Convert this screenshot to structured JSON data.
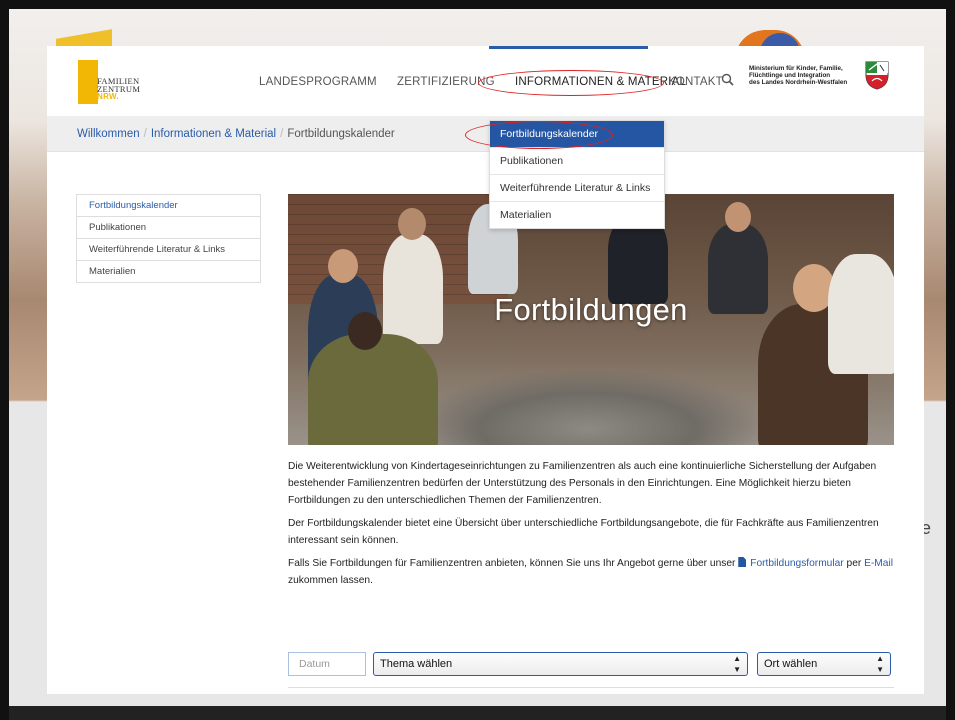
{
  "backdrop": {
    "side_text": "e"
  },
  "logo": {
    "line1": "FAMILIEN",
    "line2": "ZENTRUM",
    "line3": "NRW."
  },
  "nav": {
    "items": [
      "LANDESPROGRAMM",
      "ZERTIFIZIERUNG",
      "INFORMATIONEN & MATERIAL",
      "KONTAKT"
    ],
    "active": "INFORMATIONEN & MATERIAL"
  },
  "ministry": {
    "line1": "Ministerium für Kinder, Familie,",
    "line2": "Flüchtlinge und Integration",
    "line3": "des Landes Nordrhein-Westfalen"
  },
  "breadcrumb": {
    "home": "Willkommen",
    "section": "Informationen & Material",
    "current": "Fortbildungskalender",
    "separator": "/"
  },
  "dropdown": {
    "items": [
      "Fortbildungskalender",
      "Publikationen",
      "Weiterführende Literatur & Links",
      "Materialien"
    ],
    "active_index": 0
  },
  "sidebar": {
    "items": [
      "Fortbildungskalender",
      "Publikationen",
      "Weiterführende Literatur & Links",
      "Materialien"
    ],
    "active_index": 0
  },
  "hero": {
    "title": "Fortbildungen"
  },
  "content": {
    "p1": "Die Weiterentwicklung von Kindertageseinrichtungen zu Familienzentren als auch eine kontinuierliche Sicherstellung der Aufgaben bestehender Familienzentren bedürfen der Unterstützung des Personals in den Einrichtungen. Eine Möglichkeit hierzu bieten Fortbildungen zu den unterschiedlichen Themen der Familienzentren.",
    "p2": "Der Fortbildungskalender bietet eine Übersicht über unterschiedliche Fortbildungsangebote, die für Fachkräfte aus Familienzentren interessant sein können.",
    "p3_before": "Falls Sie Fortbildungen für Familienzentren anbieten, können Sie uns Ihr Angebot gerne über unser",
    "p3_link1": "Fortbildungsformular",
    "p3_middle": "per",
    "p3_link2": "E-Mail",
    "p3_after": "zukommen lassen."
  },
  "filters": {
    "date_placeholder": "Datum",
    "topic_selected": "Thema wählen",
    "place_selected": "Ort wählen"
  },
  "colors": {
    "accent": "#2456a4",
    "annotation": "#dd2222",
    "logo_yellow": "#f2b705"
  }
}
